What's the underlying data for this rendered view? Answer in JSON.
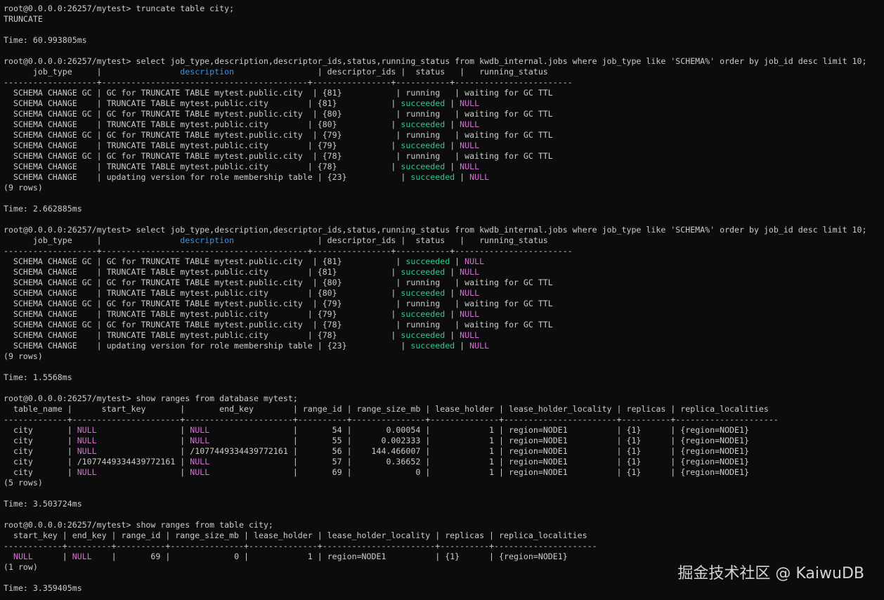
{
  "colors": {
    "background": "#0c0c0c",
    "text": "#cccccc",
    "header_blue": "#3b8eea",
    "status_green": "#23d18b",
    "null_magenta": "#d670d6"
  },
  "lines": [
    {
      "segments": [
        {
          "t": "root@0.0.0.0:26257/mytest> truncate table city;"
        }
      ]
    },
    {
      "segments": [
        {
          "t": "TRUNCATE"
        }
      ]
    },
    {
      "segments": [
        {
          "t": ""
        }
      ]
    },
    {
      "segments": [
        {
          "t": "Time: 60.993805ms"
        }
      ]
    },
    {
      "segments": [
        {
          "t": ""
        }
      ]
    },
    {
      "segments": [
        {
          "t": "root@0.0.0.0:26257/mytest> select job_type,description,descriptor_ids,status,running_status from kwdb_internal.jobs where job_type like 'SCHEMA%' order by job_id desc limit 10;"
        }
      ]
    },
    {
      "segments": [
        {
          "t": "      job_type     |                "
        },
        {
          "t": "description",
          "c": "blue"
        },
        {
          "t": "                 | descriptor_ids |  status   |   running_status"
        }
      ]
    },
    {
      "segments": [
        {
          "t": "-------------------+------------------------------------------+----------------+-----------+------------------------"
        }
      ]
    },
    {
      "segments": [
        {
          "t": "  SCHEMA CHANGE GC | GC for TRUNCATE TABLE mytest.public.city  | {81}           | running   | waiting for GC TTL"
        }
      ]
    },
    {
      "segments": [
        {
          "t": "  SCHEMA CHANGE    | TRUNCATE TABLE mytest.public.city        | {81}           | "
        },
        {
          "t": "succeeded",
          "c": "green"
        },
        {
          "t": " | "
        },
        {
          "t": "NULL",
          "c": "mag"
        }
      ]
    },
    {
      "segments": [
        {
          "t": "  SCHEMA CHANGE GC | GC for TRUNCATE TABLE mytest.public.city  | {80}           | running   | waiting for GC TTL"
        }
      ]
    },
    {
      "segments": [
        {
          "t": "  SCHEMA CHANGE    | TRUNCATE TABLE mytest.public.city        | {80}           | "
        },
        {
          "t": "succeeded",
          "c": "green"
        },
        {
          "t": " | "
        },
        {
          "t": "NULL",
          "c": "mag"
        }
      ]
    },
    {
      "segments": [
        {
          "t": "  SCHEMA CHANGE GC | GC for TRUNCATE TABLE mytest.public.city  | {79}           | running   | waiting for GC TTL"
        }
      ]
    },
    {
      "segments": [
        {
          "t": "  SCHEMA CHANGE    | TRUNCATE TABLE mytest.public.city        | {79}           | "
        },
        {
          "t": "succeeded",
          "c": "green"
        },
        {
          "t": " | "
        },
        {
          "t": "NULL",
          "c": "mag"
        }
      ]
    },
    {
      "segments": [
        {
          "t": "  SCHEMA CHANGE GC | GC for TRUNCATE TABLE mytest.public.city  | {78}           | running   | waiting for GC TTL"
        }
      ]
    },
    {
      "segments": [
        {
          "t": "  SCHEMA CHANGE    | TRUNCATE TABLE mytest.public.city        | {78}           | "
        },
        {
          "t": "succeeded",
          "c": "green"
        },
        {
          "t": " | "
        },
        {
          "t": "NULL",
          "c": "mag"
        }
      ]
    },
    {
      "segments": [
        {
          "t": "  SCHEMA CHANGE    | updating version for role membership table | {23}           | "
        },
        {
          "t": "succeeded",
          "c": "green"
        },
        {
          "t": " | "
        },
        {
          "t": "NULL",
          "c": "mag"
        }
      ]
    },
    {
      "segments": [
        {
          "t": "(9 rows)"
        }
      ]
    },
    {
      "segments": [
        {
          "t": ""
        }
      ]
    },
    {
      "segments": [
        {
          "t": "Time: 2.662885ms"
        }
      ]
    },
    {
      "segments": [
        {
          "t": ""
        }
      ]
    },
    {
      "segments": [
        {
          "t": "root@0.0.0.0:26257/mytest> select job_type,description,descriptor_ids,status,running_status from kwdb_internal.jobs where job_type like 'SCHEMA%' order by job_id desc limit 10;"
        }
      ]
    },
    {
      "segments": [
        {
          "t": "      job_type     |                "
        },
        {
          "t": "description",
          "c": "blue"
        },
        {
          "t": "                 | descriptor_ids |  status   |   running_status"
        }
      ]
    },
    {
      "segments": [
        {
          "t": "-------------------+------------------------------------------+----------------+-----------+------------------------"
        }
      ]
    },
    {
      "segments": [
        {
          "t": "  SCHEMA CHANGE GC | GC for TRUNCATE TABLE mytest.public.city  | {81}           | "
        },
        {
          "t": "succeeded",
          "c": "green"
        },
        {
          "t": " | "
        },
        {
          "t": "NULL",
          "c": "mag"
        }
      ]
    },
    {
      "segments": [
        {
          "t": "  SCHEMA CHANGE    | TRUNCATE TABLE mytest.public.city        | {81}           | "
        },
        {
          "t": "succeeded",
          "c": "green"
        },
        {
          "t": " | "
        },
        {
          "t": "NULL",
          "c": "mag"
        }
      ]
    },
    {
      "segments": [
        {
          "t": "  SCHEMA CHANGE GC | GC for TRUNCATE TABLE mytest.public.city  | {80}           | running   | waiting for GC TTL"
        }
      ]
    },
    {
      "segments": [
        {
          "t": "  SCHEMA CHANGE    | TRUNCATE TABLE mytest.public.city        | {80}           | "
        },
        {
          "t": "succeeded",
          "c": "green"
        },
        {
          "t": " | "
        },
        {
          "t": "NULL",
          "c": "mag"
        }
      ]
    },
    {
      "segments": [
        {
          "t": "  SCHEMA CHANGE GC | GC for TRUNCATE TABLE mytest.public.city  | {79}           | running   | waiting for GC TTL"
        }
      ]
    },
    {
      "segments": [
        {
          "t": "  SCHEMA CHANGE    | TRUNCATE TABLE mytest.public.city        | {79}           | "
        },
        {
          "t": "succeeded",
          "c": "green"
        },
        {
          "t": " | "
        },
        {
          "t": "NULL",
          "c": "mag"
        }
      ]
    },
    {
      "segments": [
        {
          "t": "  SCHEMA CHANGE GC | GC for TRUNCATE TABLE mytest.public.city  | {78}           | running   | waiting for GC TTL"
        }
      ]
    },
    {
      "segments": [
        {
          "t": "  SCHEMA CHANGE    | TRUNCATE TABLE mytest.public.city        | {78}           | "
        },
        {
          "t": "succeeded",
          "c": "green"
        },
        {
          "t": " | "
        },
        {
          "t": "NULL",
          "c": "mag"
        }
      ]
    },
    {
      "segments": [
        {
          "t": "  SCHEMA CHANGE    | updating version for role membership table | {23}           | "
        },
        {
          "t": "succeeded",
          "c": "green"
        },
        {
          "t": " | "
        },
        {
          "t": "NULL",
          "c": "mag"
        }
      ]
    },
    {
      "segments": [
        {
          "t": "(9 rows)"
        }
      ]
    },
    {
      "segments": [
        {
          "t": ""
        }
      ]
    },
    {
      "segments": [
        {
          "t": "Time: 1.5568ms"
        }
      ]
    },
    {
      "segments": [
        {
          "t": ""
        }
      ]
    },
    {
      "segments": [
        {
          "t": "root@0.0.0.0:26257/mytest> show ranges from database mytest;"
        }
      ]
    },
    {
      "segments": [
        {
          "t": "  table_name |      start_key       |       end_key        | range_id | range_size_mb | lease_holder | lease_holder_locality | replicas | replica_localities"
        }
      ]
    },
    {
      "segments": [
        {
          "t": "-------------+----------------------+----------------------+----------+---------------+--------------+-----------------------+----------+---------------------"
        }
      ]
    },
    {
      "segments": [
        {
          "t": "  city       | "
        },
        {
          "t": "NULL",
          "c": "mag"
        },
        {
          "t": "                 | "
        },
        {
          "t": "NULL",
          "c": "mag"
        },
        {
          "t": "                 |       54 |       0.00054 |            1 | region=NODE1          | {1}      | {region=NODE1}"
        }
      ]
    },
    {
      "segments": [
        {
          "t": "  city       | "
        },
        {
          "t": "NULL",
          "c": "mag"
        },
        {
          "t": "                 | "
        },
        {
          "t": "NULL",
          "c": "mag"
        },
        {
          "t": "                 |       55 |      0.002333 |            1 | region=NODE1          | {1}      | {region=NODE1}"
        }
      ]
    },
    {
      "segments": [
        {
          "t": "  city       | "
        },
        {
          "t": "NULL",
          "c": "mag"
        },
        {
          "t": "                 | /1077449334439772161 |       56 |    144.466007 |            1 | region=NODE1          | {1}      | {region=NODE1}"
        }
      ]
    },
    {
      "segments": [
        {
          "t": "  city       | /1077449334439772161 | "
        },
        {
          "t": "NULL",
          "c": "mag"
        },
        {
          "t": "                 |       57 |       0.36652 |            1 | region=NODE1          | {1}      | {region=NODE1}"
        }
      ]
    },
    {
      "segments": [
        {
          "t": "  city       | "
        },
        {
          "t": "NULL",
          "c": "mag"
        },
        {
          "t": "                 | "
        },
        {
          "t": "NULL",
          "c": "mag"
        },
        {
          "t": "                 |       69 |             0 |            1 | region=NODE1          | {1}      | {region=NODE1}"
        }
      ]
    },
    {
      "segments": [
        {
          "t": "(5 rows)"
        }
      ]
    },
    {
      "segments": [
        {
          "t": ""
        }
      ]
    },
    {
      "segments": [
        {
          "t": "Time: 3.503724ms"
        }
      ]
    },
    {
      "segments": [
        {
          "t": ""
        }
      ]
    },
    {
      "segments": [
        {
          "t": "root@0.0.0.0:26257/mytest> show ranges from table city;"
        }
      ]
    },
    {
      "segments": [
        {
          "t": "  start_key | end_key | range_id | range_size_mb | lease_holder | lease_holder_locality | replicas | replica_localities"
        }
      ]
    },
    {
      "segments": [
        {
          "t": "------------+---------+----------+---------------+--------------+-----------------------+----------+---------------------"
        }
      ]
    },
    {
      "segments": [
        {
          "t": "  "
        },
        {
          "t": "NULL",
          "c": "mag"
        },
        {
          "t": "      | "
        },
        {
          "t": "NULL",
          "c": "mag"
        },
        {
          "t": "    |       69 |             0 |            1 | region=NODE1          | {1}      | {region=NODE1}"
        }
      ]
    },
    {
      "segments": [
        {
          "t": "(1 row)"
        }
      ]
    },
    {
      "segments": [
        {
          "t": ""
        }
      ]
    },
    {
      "segments": [
        {
          "t": "Time: 3.359405ms"
        }
      ]
    }
  ],
  "watermark": "掘金技术社区 @ KaiwuDB"
}
